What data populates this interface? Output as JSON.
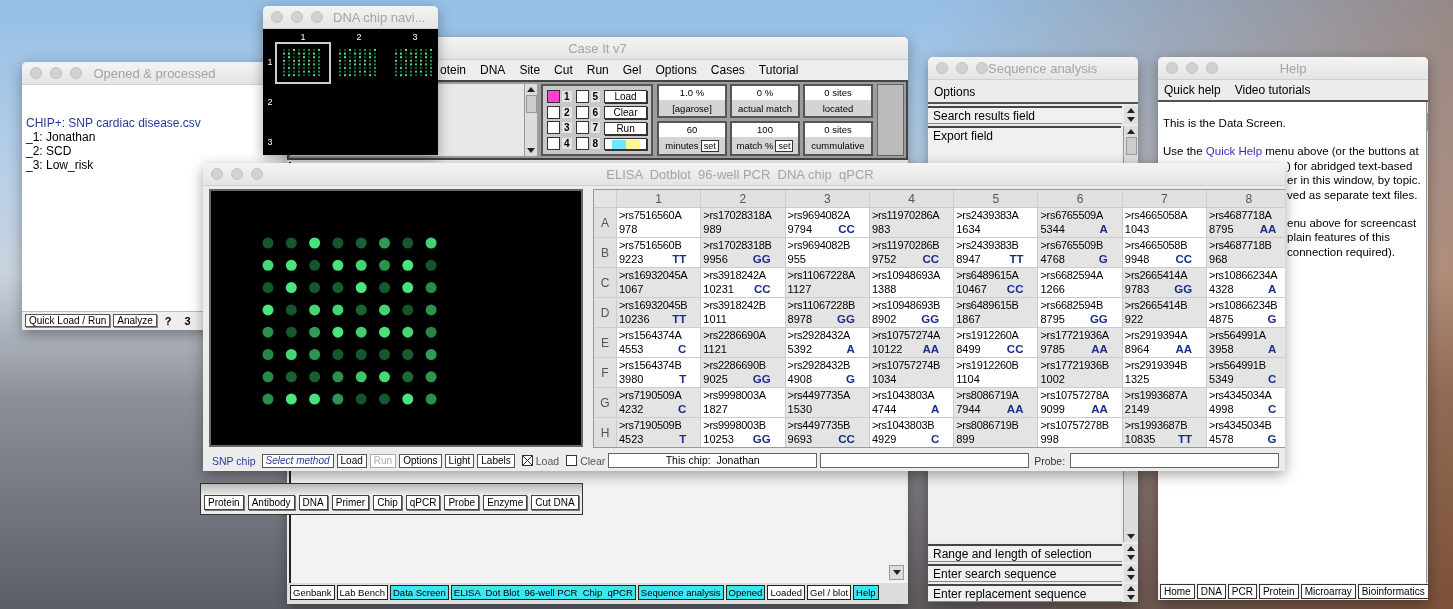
{
  "opened_window": {
    "title": "Opened & processed",
    "heading": "CHIP+: SNP cardiac disease.csv",
    "items": [
      "_1: Jonathan",
      "_2: SCD",
      "_3: Low_risk"
    ],
    "buttons": [
      {
        "kind": "button",
        "label": "Quick Load / Run"
      },
      {
        "kind": "button",
        "label": "Analyze"
      },
      {
        "kind": "text",
        "label": "?"
      },
      {
        "kind": "text",
        "label": "3"
      }
    ]
  },
  "navigator_window": {
    "title": "DNA chip navi...",
    "columns": [
      "1",
      "2",
      "3"
    ],
    "rows": [
      "1",
      "2",
      "3"
    ],
    "chips": [
      {
        "selected": true
      },
      {
        "selected": false
      },
      {
        "selected": false
      }
    ]
  },
  "case_it_window": {
    "title": "Case It v7",
    "menu": [
      "otein",
      "DNA",
      "Site",
      "Cut",
      "Run",
      "Gel",
      "Options",
      "Cases",
      "Tutorial"
    ],
    "lanes": [
      {
        "label": "1",
        "checked": true
      },
      {
        "label": "2",
        "checked": false
      },
      {
        "label": "3",
        "checked": false
      },
      {
        "label": "4",
        "checked": false
      },
      {
        "label": "5",
        "checked": false
      },
      {
        "label": "6",
        "checked": false
      },
      {
        "label": "7",
        "checked": false
      },
      {
        "label": "8",
        "checked": false
      }
    ],
    "lane_buttons": [
      {
        "kind": "text",
        "label": "Load"
      },
      {
        "kind": "text",
        "label": "Clear"
      },
      {
        "kind": "text",
        "label": "Run"
      },
      {
        "kind": "swatch"
      }
    ],
    "readouts": [
      {
        "value": "1.0 %",
        "label": "[agarose]"
      },
      {
        "value": "0 %",
        "label": "actual match"
      },
      {
        "value": "0 sites",
        "label": "located"
      },
      {
        "value": "60",
        "label": "minutes",
        "button": "set"
      },
      {
        "value": "100",
        "label": "match %",
        "button": "set"
      },
      {
        "value": "0 sites",
        "label": "cummulative"
      }
    ],
    "tabs": [
      {
        "label": "Genbank",
        "active": false
      },
      {
        "label": "Lab Bench",
        "active": false
      },
      {
        "label": "Data Screen",
        "active": true
      },
      {
        "label": "ELISA  Dot Blot  96-well PCR  Chip  qPCR",
        "active": true
      },
      {
        "label": "Sequence analysis",
        "active": true
      },
      {
        "label": "Opened",
        "active": true
      },
      {
        "label": "Loaded",
        "active": false
      },
      {
        "label": "Gel / blot",
        "active": false
      },
      {
        "label": "Help",
        "active": true
      }
    ]
  },
  "palette": {
    "buttons": [
      "Protein",
      "Antibody",
      "DNA",
      "Primer",
      "Chip",
      "qPCR",
      "Probe",
      "Enzyme",
      "Cut DNA"
    ]
  },
  "sequence_window": {
    "title": "Sequence analysis",
    "menu": [
      "Options"
    ],
    "search_field": "Search results field",
    "export_field": "Export field",
    "bottom_fields": [
      "Range and length of selection",
      "Enter search sequence",
      "Enter replacement sequence"
    ]
  },
  "help_window": {
    "title": "Help",
    "menu": [
      "Quick help",
      "Video tutorials"
    ],
    "paragraphs": [
      {
        "lines": [
          {
            "kind": "full",
            "text": "This is the Data Screen."
          }
        ]
      },
      {
        "lines": [
          {
            "kind": "full",
            "text": "Use the **Quick Help** menu above (or the buttons at"
          },
          {
            "kind": "tail",
            "text": ") for abridged text-based"
          },
          {
            "kind": "tail",
            "text": "er in this window, by topic."
          },
          {
            "kind": "tail",
            "text": "ved as separate text files."
          }
        ]
      },
      {
        "lines": [
          {
            "kind": "tail",
            "text": "enu above for screencast"
          },
          {
            "kind": "tail",
            "text": "plain features of this"
          },
          {
            "kind": "tail",
            "text": "connection required)."
          }
        ]
      }
    ],
    "buttons": [
      "Home",
      "DNA",
      "PCR",
      "Protein",
      "Microarray",
      "Bioinformatics"
    ]
  },
  "elisa_window": {
    "title": "ELISA  Dotblot  96-well PCR  DNA chip  qPCR",
    "columns": [
      "1",
      "2",
      "3",
      "4",
      "5",
      "6",
      "7",
      "8"
    ],
    "rows": [
      {
        "label": "A",
        "cells": [
          {
            "probe": ">rs7516560A",
            "value": "978"
          },
          {
            "probe": ">rs17028318A",
            "value": "989"
          },
          {
            "probe": ">rs9694082A",
            "value": "9794",
            "call": "CC"
          },
          {
            "probe": ">rs11970286A",
            "value": "983"
          },
          {
            "probe": ">rs2439383A",
            "value": "1634"
          },
          {
            "probe": ">rs6765509A",
            "value": "5344",
            "call": "A"
          },
          {
            "probe": ">rs4665058A",
            "value": "1043"
          },
          {
            "probe": ">rs4687718A",
            "value": "8795",
            "call": "AA"
          }
        ]
      },
      {
        "label": "B",
        "cells": [
          {
            "probe": ">rs7516560B",
            "value": "9223",
            "call": "TT"
          },
          {
            "probe": ">rs17028318B",
            "value": "9956",
            "call": "GG"
          },
          {
            "probe": ">rs9694082B",
            "value": "955"
          },
          {
            "probe": ">rs11970286B",
            "value": "9752",
            "call": "CC"
          },
          {
            "probe": ">rs2439383B",
            "value": "8947",
            "call": "TT"
          },
          {
            "probe": ">rs6765509B",
            "value": "4768",
            "call": "G"
          },
          {
            "probe": ">rs4665058B",
            "value": "9948",
            "call": "CC"
          },
          {
            "probe": ">rs4687718B",
            "value": "968"
          }
        ]
      },
      {
        "label": "C",
        "cells": [
          {
            "probe": ">rs16932045A",
            "value": "1067"
          },
          {
            "probe": ">rs3918242A",
            "value": "10231",
            "call": "CC"
          },
          {
            "probe": ">rs11067228A",
            "value": "1127"
          },
          {
            "probe": ">rs10948693A",
            "value": "1388"
          },
          {
            "probe": ">rs6489615A",
            "value": "10467",
            "call": "CC"
          },
          {
            "probe": ">rs6682594A",
            "value": "1266"
          },
          {
            "probe": ">rs2665414A",
            "value": "9783",
            "call": "GG"
          },
          {
            "probe": ">rs10866234A",
            "value": "4328",
            "call": "A"
          }
        ]
      },
      {
        "label": "D",
        "cells": [
          {
            "probe": ">rs16932045B",
            "value": "10236",
            "call": "TT"
          },
          {
            "probe": ">rs3918242B",
            "value": "1011"
          },
          {
            "probe": ">rs11067228B",
            "value": "8978",
            "call": "GG"
          },
          {
            "probe": ">rs10948693B",
            "value": "8902",
            "call": "GG"
          },
          {
            "probe": ">rs6489615B",
            "value": "1867"
          },
          {
            "probe": ">rs6682594B",
            "value": "8795",
            "call": "GG"
          },
          {
            "probe": ">rs2665414B",
            "value": "922"
          },
          {
            "probe": ">rs10866234B",
            "value": "4875",
            "call": "G"
          }
        ]
      },
      {
        "label": "E",
        "cells": [
          {
            "probe": ">rs1564374A",
            "value": "4553",
            "call": "C"
          },
          {
            "probe": ">rs2286690A",
            "value": "1121"
          },
          {
            "probe": ">rs2928432A",
            "value": "5392",
            "call": "A"
          },
          {
            "probe": ">rs10757274A",
            "value": "10122",
            "call": "AA"
          },
          {
            "probe": ">rs1912260A",
            "value": "8499",
            "call": "CC"
          },
          {
            "probe": ">rs17721936A",
            "value": "9785",
            "call": "AA"
          },
          {
            "probe": ">rs2919394A",
            "value": "8964",
            "call": "AA"
          },
          {
            "probe": ">rs564991A",
            "value": "3958",
            "call": "A"
          }
        ]
      },
      {
        "label": "F",
        "cells": [
          {
            "probe": ">rs1564374B",
            "value": "3980",
            "call": "T"
          },
          {
            "probe": ">rs2286690B",
            "value": "9025",
            "call": "GG"
          },
          {
            "probe": ">rs2928432B",
            "value": "4908",
            "call": "G"
          },
          {
            "probe": ">rs10757274B",
            "value": "1034"
          },
          {
            "probe": ">rs1912260B",
            "value": "1104"
          },
          {
            "probe": ">rs17721936B",
            "value": "1002"
          },
          {
            "probe": ">rs2919394B",
            "value": "1325"
          },
          {
            "probe": ">rs564991B",
            "value": "5349",
            "call": "C"
          }
        ]
      },
      {
        "label": "G",
        "cells": [
          {
            "probe": ">rs7190509A",
            "value": "4232",
            "call": "C"
          },
          {
            "probe": ">rs9998003A",
            "value": "1827"
          },
          {
            "probe": ">rs4497735A",
            "value": "1530"
          },
          {
            "probe": ">rs1043803A",
            "value": "4744",
            "call": "A"
          },
          {
            "probe": ">rs8086719A",
            "value": "7944",
            "call": "AA"
          },
          {
            "probe": ">rs10757278A",
            "value": "9099",
            "call": "AA"
          },
          {
            "probe": ">rs1993687A",
            "value": "2149"
          },
          {
            "probe": ">rs4345034A",
            "value": "4998",
            "call": "C"
          }
        ]
      },
      {
        "label": "H",
        "cells": [
          {
            "probe": ">rs7190509B",
            "value": "4523",
            "call": "T"
          },
          {
            "probe": ">rs9998003B",
            "value": "10253",
            "call": "GG"
          },
          {
            "probe": ">rs4497735B",
            "value": "9693",
            "call": "CC"
          },
          {
            "probe": ">rs1043803B",
            "value": "4929",
            "call": "C"
          },
          {
            "probe": ">rs8086719B",
            "value": "899"
          },
          {
            "probe": ">rs10757278B",
            "value": "998"
          },
          {
            "probe": ">rs1993687B",
            "value": "10835",
            "call": "TT"
          },
          {
            "probe": ">rs4345034B",
            "value": "4578",
            "call": "G"
          }
        ]
      }
    ],
    "toolbar": [
      {
        "kind": "mode",
        "text": "SNP chip"
      },
      {
        "kind": "menu",
        "text": "Select method"
      },
      {
        "kind": "button",
        "text": "Load",
        "disabled": false
      },
      {
        "kind": "button",
        "text": "Run",
        "disabled": true
      },
      {
        "kind": "button",
        "text": "Options",
        "disabled": false
      },
      {
        "kind": "button",
        "text": "Light",
        "disabled": false
      },
      {
        "kind": "button",
        "text": "Labels",
        "disabled": false
      },
      {
        "kind": "checkbox",
        "text": "Load",
        "checked": true
      },
      {
        "kind": "checkbox",
        "text": "Clear",
        "checked": false
      },
      {
        "kind": "field",
        "text": "This chip:  Jonathan"
      },
      {
        "kind": "field"
      },
      {
        "kind": "label",
        "text": "Probe:"
      },
      {
        "kind": "field"
      }
    ]
  }
}
